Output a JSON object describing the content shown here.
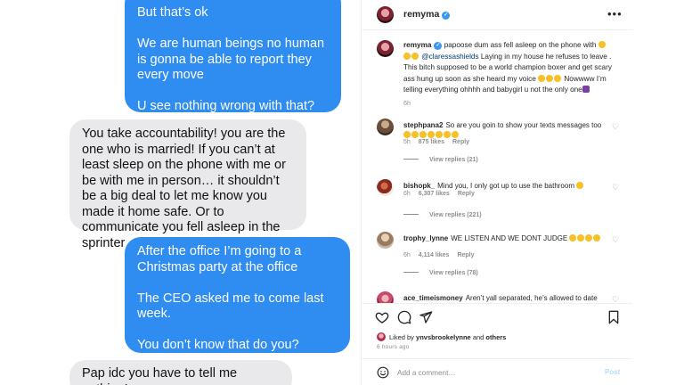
{
  "chat": {
    "messages": [
      {
        "direction": "sent",
        "text": "But that’s ok\n\nWe are human beings no human is gonna be able to report they every move\n\nU see nothing wrong with that?"
      },
      {
        "direction": "received",
        "text": "You take accountability! you are the one who is married! If you can’t at least sleep on the phone with me or be with me in person… it shouldn’t be a big deal to let me know you made it home safe. Or to communicate you fell asleep in the sprinter"
      },
      {
        "direction": "sent",
        "text": "After the office I’m going to a Christmas party at the office\n\nThe CEO asked me to come last week.\n\nYou don’t know that do you?"
      },
      {
        "direction": "received",
        "text": "Pap idc you have to tell me nothing!"
      }
    ],
    "colors": {
      "sent": "#2f8cf1",
      "received": "#e9e9eb"
    }
  },
  "post": {
    "header": {
      "username": "remyma",
      "more_icon": "more-horizontal-icon"
    },
    "caption": {
      "username": "remyma",
      "part1": "papoose dum ass fell asleep on the phone with ",
      "mention": "@claressashields",
      "part2": " Laying in my house he refuses to leave . This bitch supposed to be a world champion boxer and get scary ass hung up soon as she heard my voice ",
      "part3": " Nowwww I’m telling everything ohhhh and babygirl u not the only one",
      "time": "6h"
    },
    "comments": [
      {
        "username": "stephpana2",
        "text": "So are you goin to show your texts messages too",
        "time": "5h",
        "likes": "875 likes",
        "reply": "Reply",
        "view_replies": "View replies (21)"
      },
      {
        "username": "bishopk_",
        "text": "Mind you, I only got up to use the bathroom",
        "time": "6h",
        "likes": "6,307 likes",
        "reply": "Reply",
        "view_replies": "View replies (221)"
      },
      {
        "username": "trophy_lynne",
        "text": "WE LISTEN AND WE DONT JUDGE",
        "time": "6h",
        "likes": "4,114 likes",
        "reply": "Reply",
        "view_replies": "View replies (78)"
      },
      {
        "username": "ace_timeismoney",
        "text": "Aren’t yall separated, he’s allowed to date"
      }
    ],
    "liked_by": {
      "prefix": "Liked by ",
      "user": "ynvsbrookelynne",
      "joiner": " and ",
      "others": "others"
    },
    "age": "6 hours ago",
    "comment_placeholder": "Add a comment…",
    "post_label": "Post",
    "colors": {
      "accent": "#0095f6",
      "post_disabled": "#b2dffc",
      "verified": "#3897f0"
    }
  }
}
